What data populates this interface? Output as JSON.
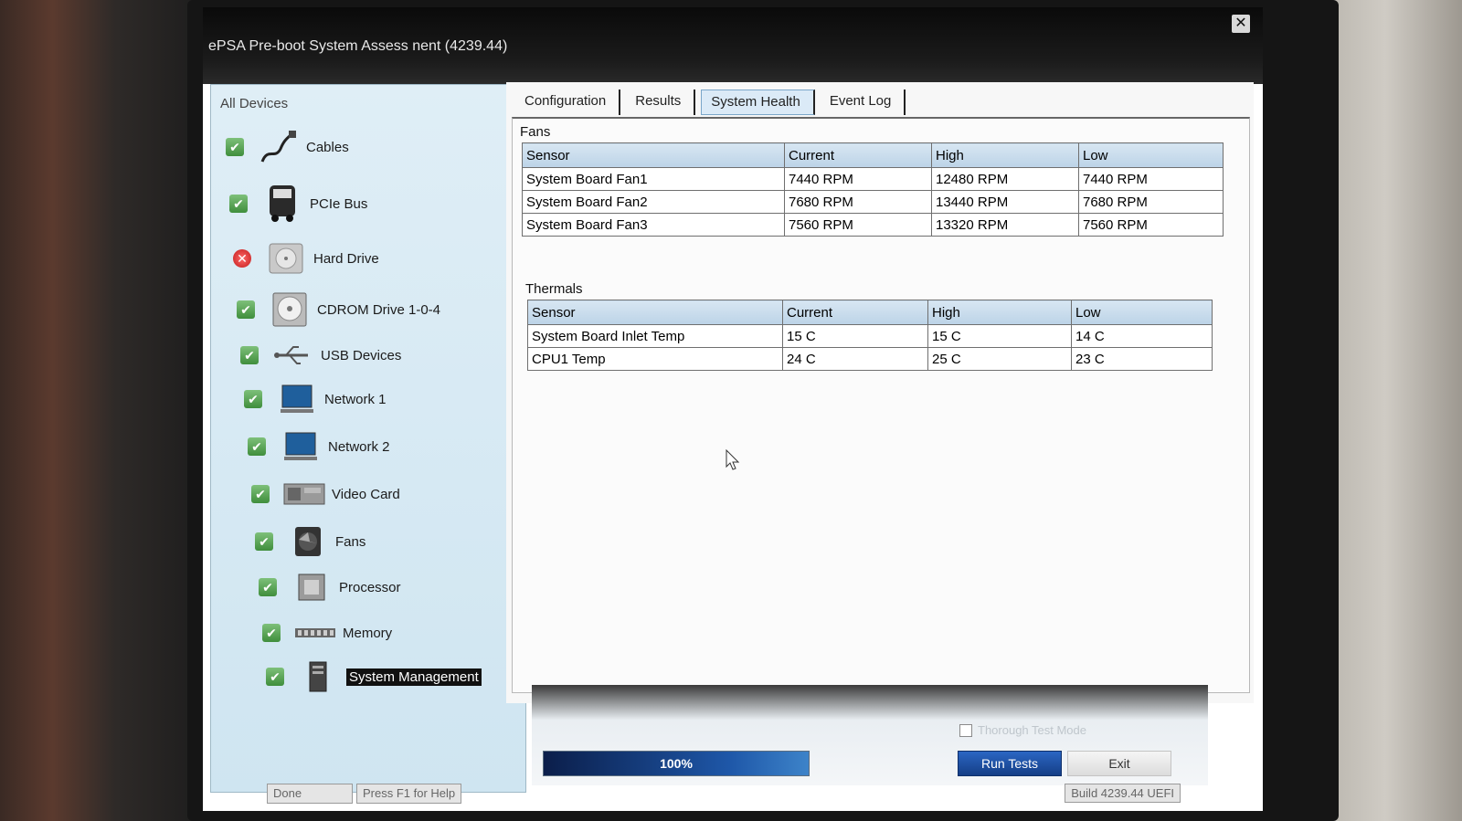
{
  "window": {
    "title": "ePSA Pre-boot System Assess nent (4239.44)",
    "close_symbol": "✕"
  },
  "device_panel": {
    "header": "All Devices",
    "items": [
      {
        "label": "Cables",
        "status": "pass",
        "icon": "cable-icon"
      },
      {
        "label": "PCIe Bus",
        "status": "pass",
        "icon": "pcie-bus-icon"
      },
      {
        "label": "Hard Drive",
        "status": "fail",
        "icon": "hard-drive-icon"
      },
      {
        "label": "CDROM Drive 1-0-4",
        "status": "pass",
        "icon": "cdrom-icon"
      },
      {
        "label": "USB Devices",
        "status": "pass",
        "icon": "usb-icon"
      },
      {
        "label": "Network 1",
        "status": "pass",
        "icon": "network-icon"
      },
      {
        "label": "Network 2",
        "status": "pass",
        "icon": "network-icon"
      },
      {
        "label": "Video Card",
        "status": "pass",
        "icon": "video-card-icon"
      },
      {
        "label": "Fans",
        "status": "pass",
        "icon": "fan-icon"
      },
      {
        "label": "Processor",
        "status": "pass",
        "icon": "processor-icon"
      },
      {
        "label": "Memory",
        "status": "pass",
        "icon": "memory-icon"
      },
      {
        "label": "System Management",
        "status": "pass",
        "icon": "system-management-icon",
        "selected": true
      }
    ]
  },
  "tabs": [
    {
      "label": "Configuration",
      "active": false
    },
    {
      "label": "Results",
      "active": false
    },
    {
      "label": "System Health",
      "active": true
    },
    {
      "label": "Event Log",
      "active": false
    }
  ],
  "fans": {
    "title": "Fans",
    "columns": [
      "Sensor",
      "Current",
      "High",
      "Low"
    ],
    "rows": [
      [
        "System Board Fan1",
        "7440 RPM",
        "12480 RPM",
        "7440 RPM"
      ],
      [
        "System Board Fan2",
        "7680 RPM",
        "13440 RPM",
        "7680 RPM"
      ],
      [
        "System Board Fan3",
        "7560 RPM",
        "13320 RPM",
        "7560 RPM"
      ]
    ]
  },
  "thermals": {
    "title": "Thermals",
    "columns": [
      "Sensor",
      "Current",
      "High",
      "Low"
    ],
    "rows": [
      [
        "System Board Inlet Temp",
        "15 C",
        "15 C",
        "14 C"
      ],
      [
        "CPU1 Temp",
        "24 C",
        "25 C",
        "23 C"
      ]
    ]
  },
  "controls": {
    "thorough_label": "Thorough Test Mode",
    "thorough_checked": false,
    "progress_label": "100%",
    "progress_value": 1.0,
    "run_label": "Run Tests",
    "exit_label": "Exit"
  },
  "status_bar": {
    "left": "Done",
    "help": "Press F1 for Help",
    "build": "Build 4239.44 UEFI"
  },
  "colors": {
    "run_button": "#153e86",
    "panel_bg": "#d6e9f4",
    "fail": "#c21b1b",
    "pass": "#3f8e3c"
  }
}
